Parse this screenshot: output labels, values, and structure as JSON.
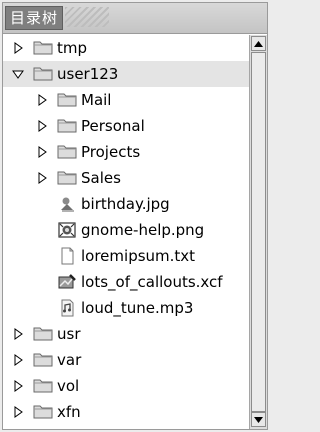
{
  "header": {
    "tab_label": "目录树"
  },
  "tree": [
    {
      "label": "tmp",
      "icon": "folder",
      "expanded": false,
      "depth": 0
    },
    {
      "label": "user123",
      "icon": "folder",
      "expanded": true,
      "depth": 0,
      "selected": true
    },
    {
      "label": "Mail",
      "icon": "folder",
      "expanded": false,
      "depth": 1
    },
    {
      "label": "Personal",
      "icon": "folder",
      "expanded": false,
      "depth": 1
    },
    {
      "label": "Projects",
      "icon": "folder",
      "expanded": false,
      "depth": 1
    },
    {
      "label": "Sales",
      "icon": "folder",
      "expanded": false,
      "depth": 1
    },
    {
      "label": "birthday.jpg",
      "icon": "image-jpg",
      "depth": 1
    },
    {
      "label": "gnome-help.png",
      "icon": "image-png",
      "depth": 1
    },
    {
      "label": "loremipsum.txt",
      "icon": "text-file",
      "depth": 1
    },
    {
      "label": "lots_of_callouts.xcf",
      "icon": "xcf-image",
      "depth": 1
    },
    {
      "label": "loud_tune.mp3",
      "icon": "audio-file",
      "depth": 1
    },
    {
      "label": "usr",
      "icon": "folder",
      "expanded": false,
      "depth": 0
    },
    {
      "label": "var",
      "icon": "folder",
      "expanded": false,
      "depth": 0
    },
    {
      "label": "vol",
      "icon": "folder",
      "expanded": false,
      "depth": 0
    },
    {
      "label": "xfn",
      "icon": "folder",
      "expanded": false,
      "depth": 0
    }
  ],
  "colors": {
    "tab_bg": "#7f7f7f",
    "selection": "#e4e4e4",
    "folder_fill": "#dcdcdc",
    "folder_stroke": "#6a6a6a"
  }
}
